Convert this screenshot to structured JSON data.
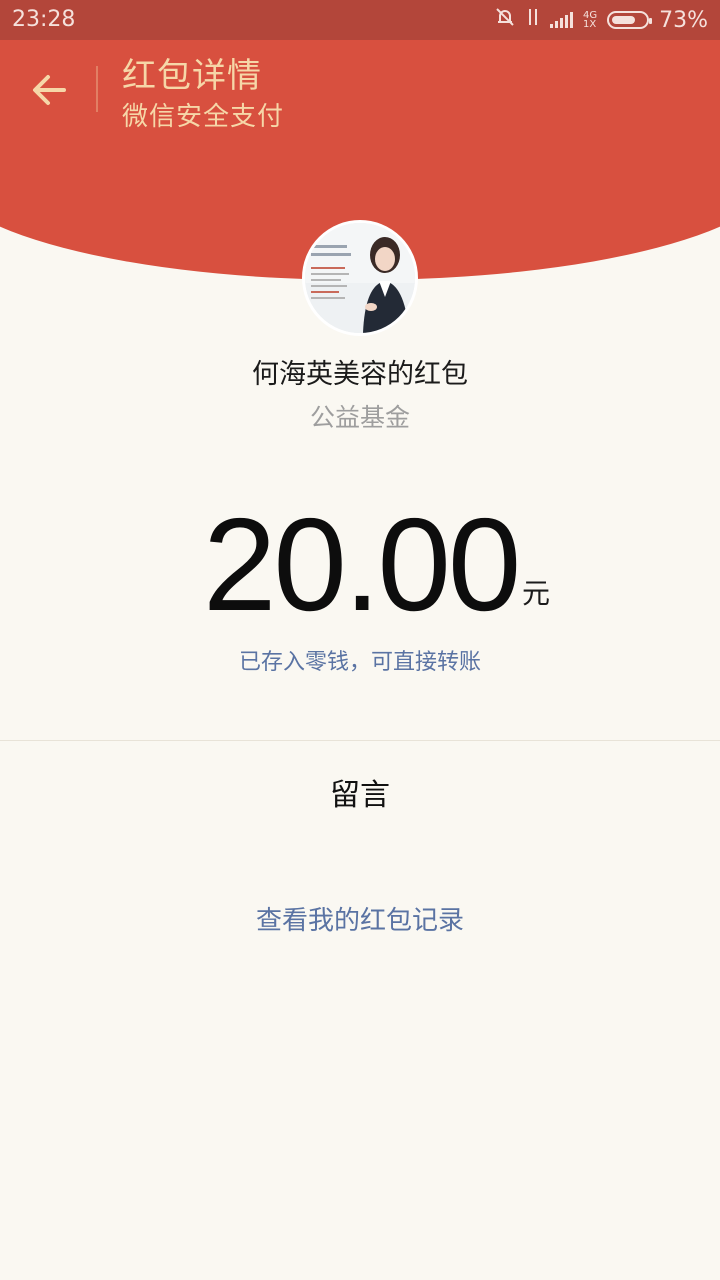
{
  "status_bar": {
    "time": "23:28",
    "network": "4G",
    "network_sub": "1X",
    "battery": "73%",
    "battery_level": 0.73,
    "icons": [
      "mute-bell-icon",
      "data-arrows-icon",
      "signal-icon",
      "battery-icon"
    ]
  },
  "header": {
    "title": "红包详情",
    "subtitle": "微信安全支付",
    "back_icon": "arrow-left-icon"
  },
  "colors": {
    "header_red": "#d8503f",
    "status_red": "#b3463a",
    "header_text": "#f6d7a8",
    "link_blue": "#5a73a3",
    "background": "#faf8f2"
  },
  "packet": {
    "sender": "何海英美容的红包",
    "message": "公益基金",
    "amount": "20.00",
    "unit": "元",
    "note": "已存入零钱，可直接转账"
  },
  "actions": {
    "leave_message": "留言",
    "view_records": "查看我的红包记录"
  }
}
